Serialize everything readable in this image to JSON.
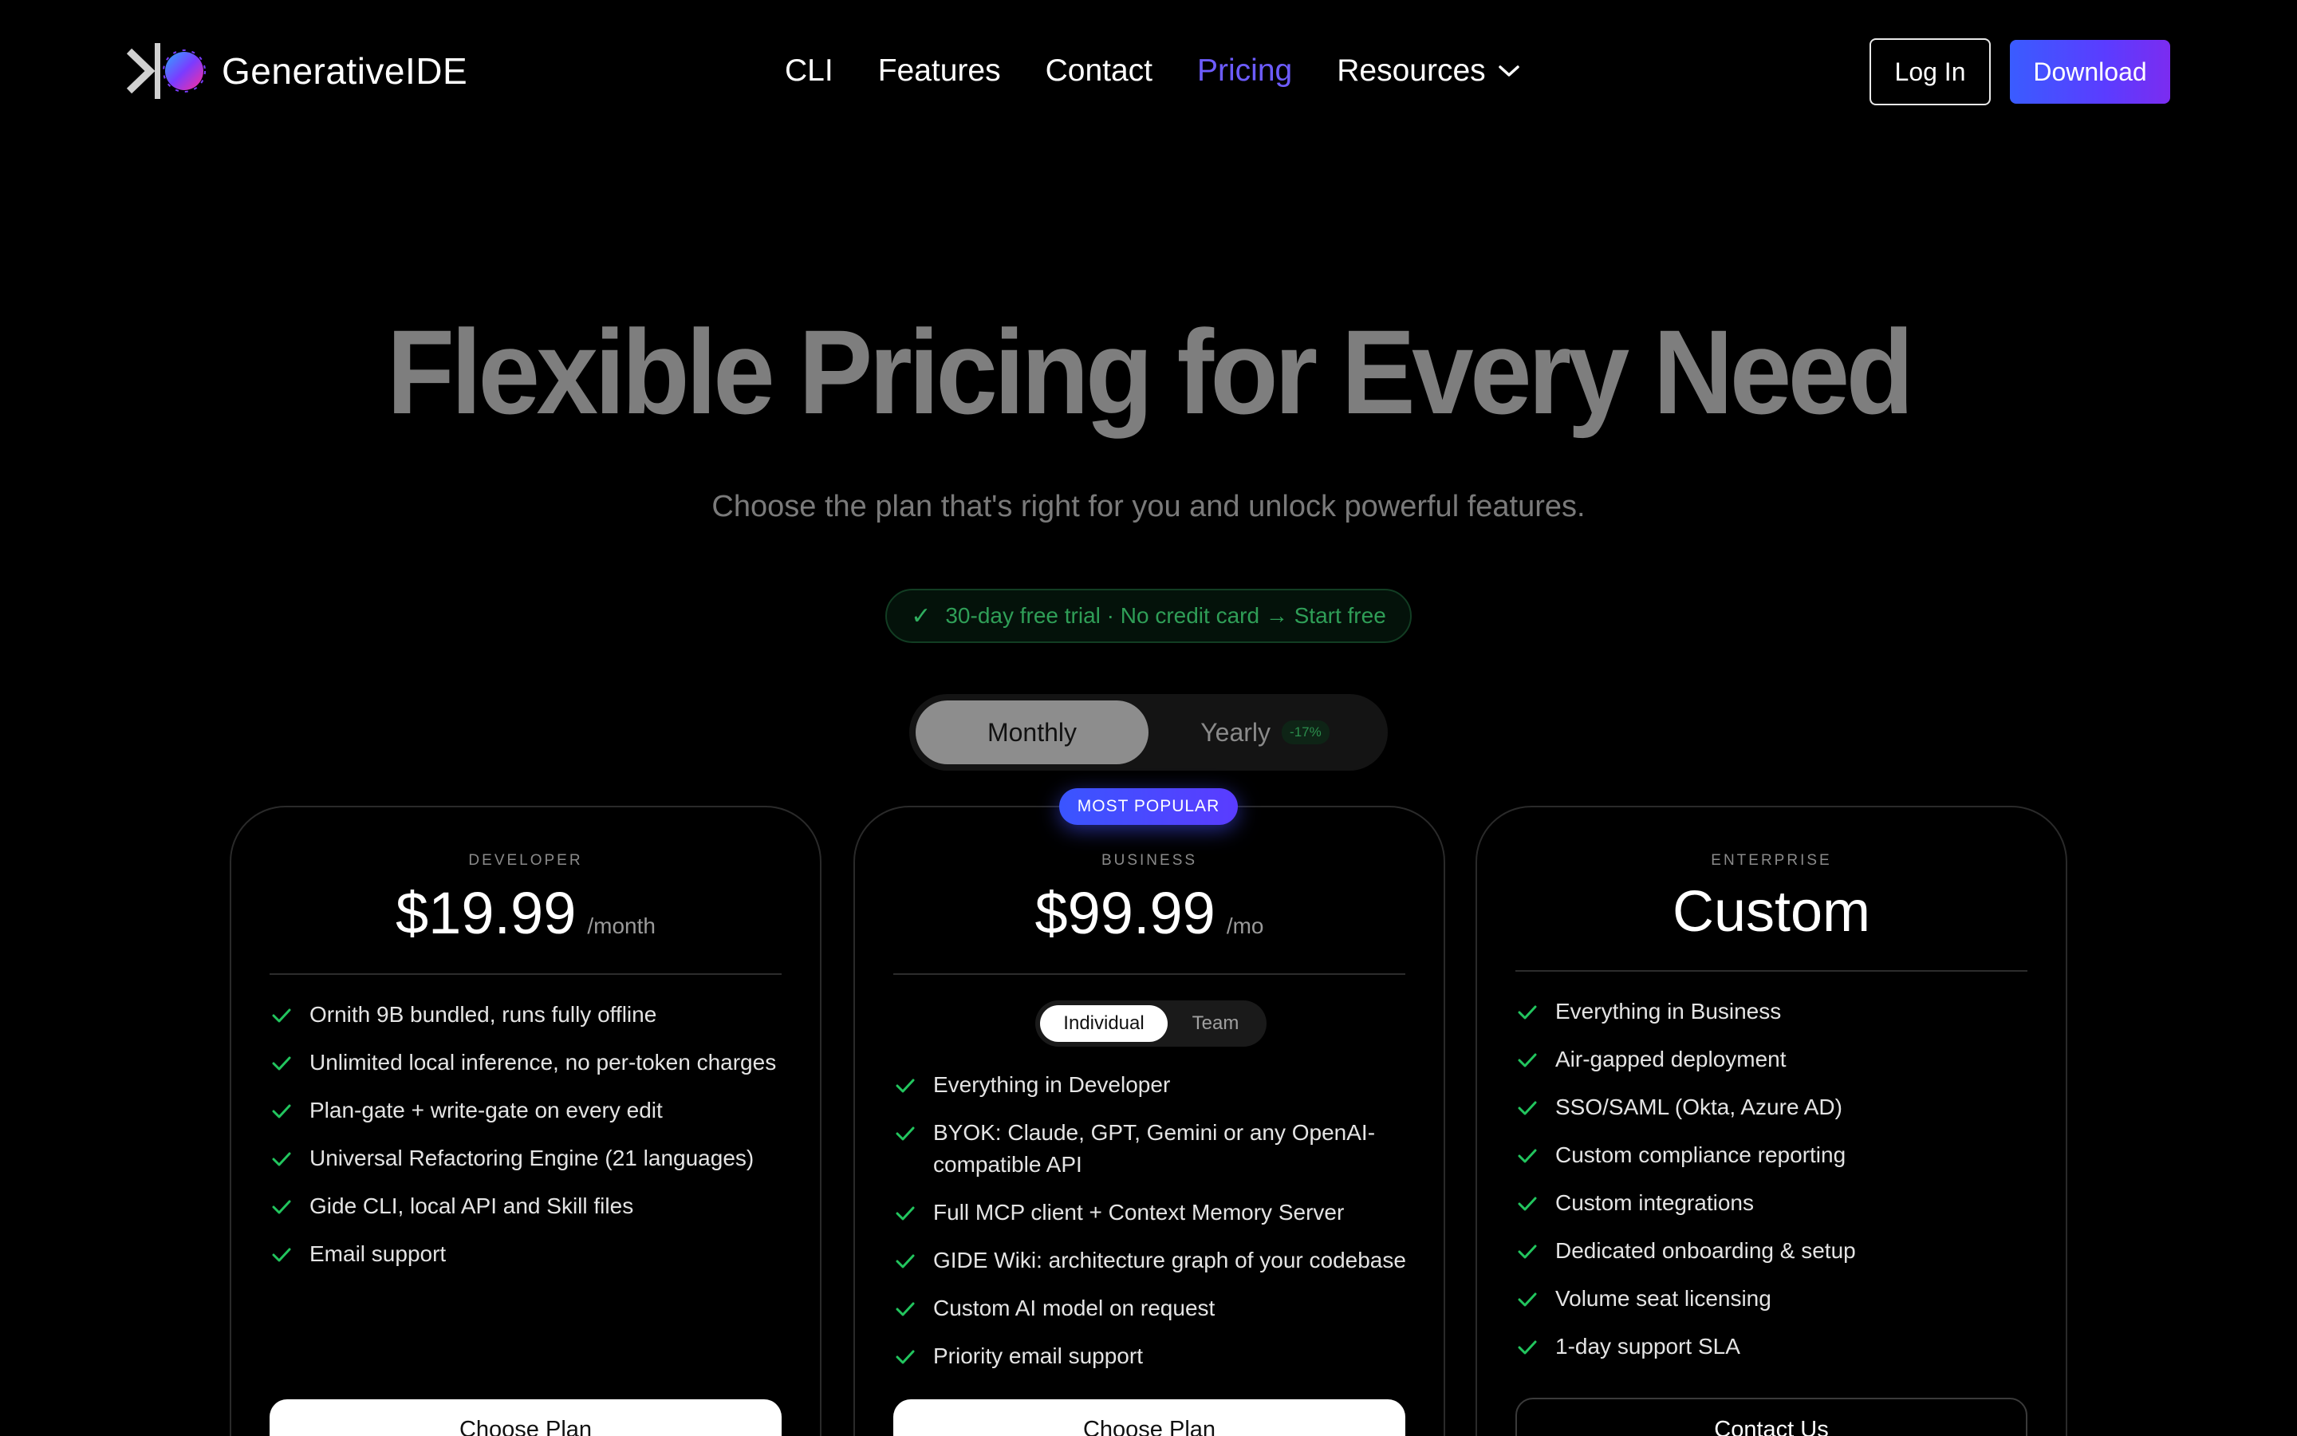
{
  "brand": {
    "name": "GenerativeIDE"
  },
  "nav": {
    "links": [
      "CLI",
      "Features",
      "Contact",
      "Pricing",
      "Resources"
    ],
    "active": "Pricing",
    "login_label": "Log In",
    "download_label": "Download"
  },
  "hero": {
    "title": "Flexible Pricing for Every Need",
    "subtitle": "Choose the plan that's right for you and unlock powerful features.",
    "trial_text": "30-day free trial · No credit card → Start free"
  },
  "billing": {
    "monthly_label": "Monthly",
    "yearly_label": "Yearly",
    "yearly_discount": "-17%",
    "selected": "Monthly"
  },
  "plans": {
    "developer": {
      "tier": "DEVELOPER",
      "price": "$19.99",
      "period": "/month",
      "features": [
        "Ornith 9B bundled, runs fully offline",
        "Unlimited local inference, no per-token charges",
        "Plan-gate + write-gate on every edit",
        "Universal Refactoring Engine (21 languages)",
        "Gide CLI, local API and Skill files",
        "Email support"
      ],
      "cta": "Choose Plan"
    },
    "business": {
      "badge": "MOST POPULAR",
      "tier": "BUSINESS",
      "price": "$99.99",
      "period": "/mo",
      "toggle": {
        "individual": "Individual",
        "team": "Team",
        "selected": "Individual"
      },
      "features": [
        "Everything in Developer",
        "BYOK: Claude, GPT, Gemini or any OpenAI-compatible API",
        "Full MCP client + Context Memory Server",
        "GIDE Wiki: architecture graph of your codebase",
        "Custom AI model on request",
        "Priority email support"
      ],
      "cta": "Choose Plan"
    },
    "enterprise": {
      "tier": "ENTERPRISE",
      "price": "Custom",
      "features": [
        "Everything in Business",
        "Air-gapped deployment",
        "SSO/SAML (Okta, Azure AD)",
        "Custom compliance reporting",
        "Custom integrations",
        "Dedicated onboarding & setup",
        "Volume seat licensing",
        "1-day support SLA"
      ],
      "cta": "Contact Us"
    }
  },
  "colors": {
    "accent": "#6d5cff",
    "check": "#22c55e",
    "trial_green": "#2f9e57",
    "background": "#000000"
  },
  "icons": {
    "logo": "generativeide-logo-icon",
    "dropdown": "chevron-down-icon",
    "feature": "check-icon",
    "trial": "checkmark-icon"
  }
}
